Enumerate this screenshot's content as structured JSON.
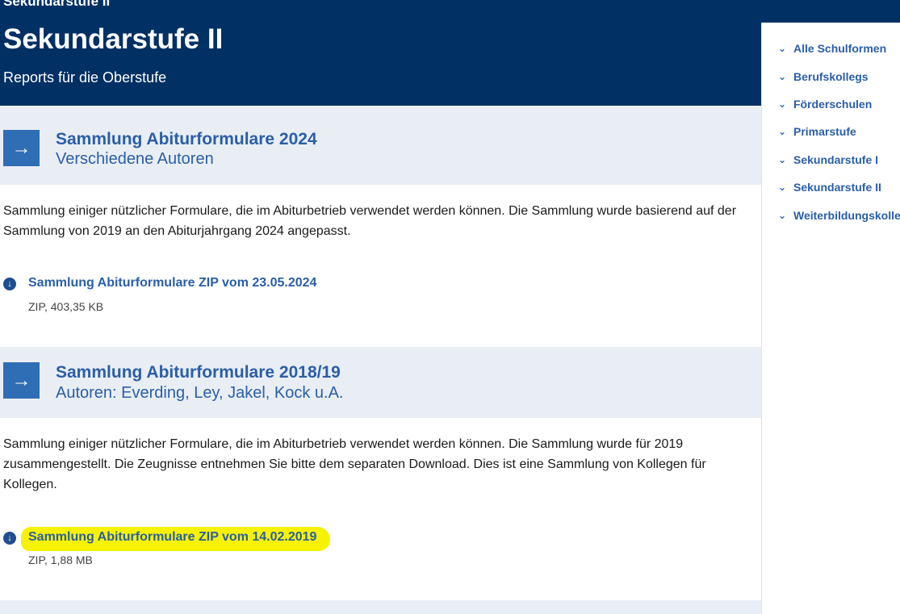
{
  "header": {
    "breadcrumb": "Sekundarstufe II",
    "title": "Sekundarstufe II",
    "subtitle": "Reports für die Oberstufe"
  },
  "sidebar": {
    "items": [
      {
        "label": "Alle Schulformen"
      },
      {
        "label": "Berufskollegs"
      },
      {
        "label": "Förderschulen"
      },
      {
        "label": "Primarstufe"
      },
      {
        "label": "Sekundarstufe I"
      },
      {
        "label": "Sekundarstufe II"
      },
      {
        "label": "Weiterbildungskolle"
      }
    ]
  },
  "cards": [
    {
      "title": "Sammlung Abiturformulare 2024",
      "author": "Verschiedene Autoren",
      "description": "Sammlung einiger nützlicher Formulare, die im Abiturbetrieb verwendet werden können. Die Sammlung wurde basierend auf der Sammlung von 2019 an den Abiturjahrgang 2024 angepasst.",
      "download_label": "Sammlung Abiturformulare ZIP vom 23.05.2024",
      "download_meta": "ZIP, 403,35 KB"
    },
    {
      "title": "Sammlung Abiturformulare 2018/19",
      "author": "Autoren: Everding, Ley, Jakel, Kock u.A.",
      "description": "Sammlung einiger nützlicher Formulare, die im Abiturbetrieb verwendet werden können. Die Sammlung wurde für 2019 zusammengestellt. Die Zeugnisse entnehmen Sie bitte dem separaten Download. Dies ist eine Sammlung von Kollegen für Kollegen.",
      "download_label": "Sammlung Abiturformulare ZIP vom 14.02.2019",
      "download_meta": "ZIP, 1,88 MB"
    }
  ],
  "icons": {
    "arrow": "→",
    "download": "↓",
    "chevron": "⌄"
  },
  "colors": {
    "header_bg": "#003064",
    "link": "#2a5ea8",
    "card_head_bg": "#e9eef5",
    "highlight": "#f7f300"
  }
}
